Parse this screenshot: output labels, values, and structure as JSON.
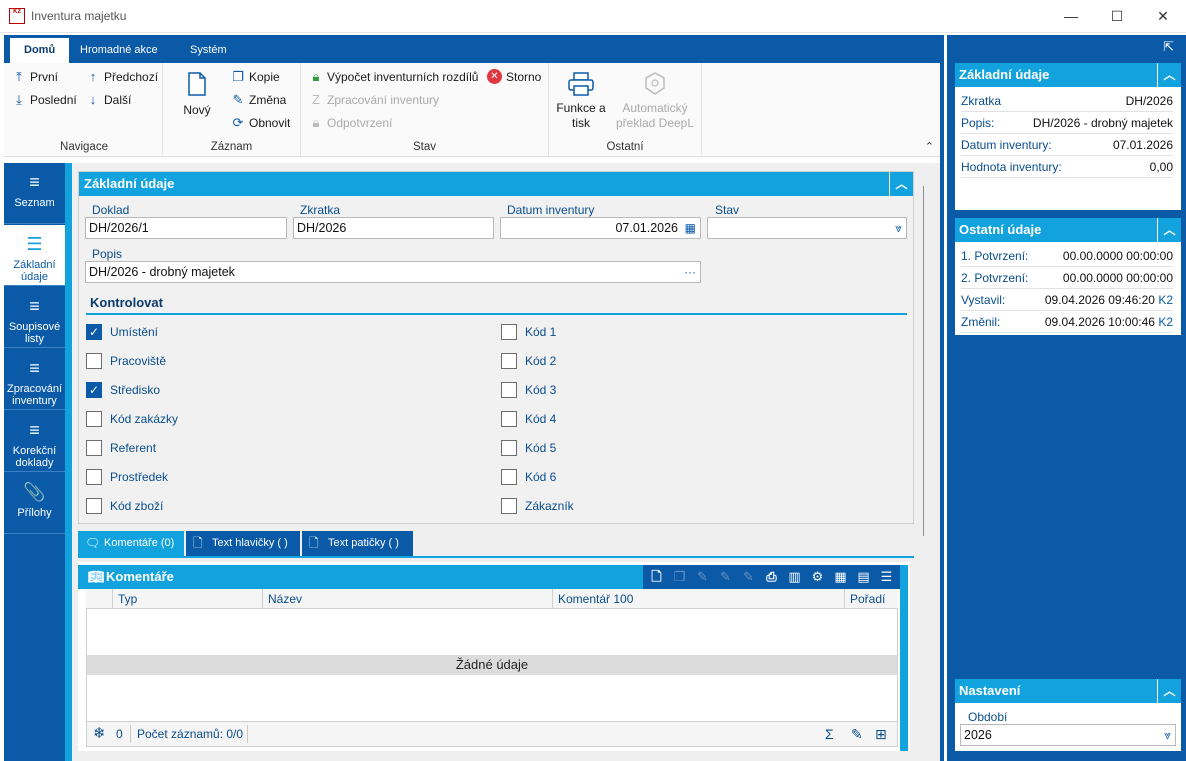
{
  "window": {
    "title": "Inventura majetku",
    "logo_text": "K2",
    "minimize": "—",
    "maximize": "☐",
    "close": "✕"
  },
  "ribbon": {
    "tabs": [
      "Domů",
      "Hromadné akce",
      "Systém"
    ],
    "navigace": {
      "label": "Navigace",
      "first": "První",
      "last": "Poslední",
      "prev": "Předchozí",
      "next": "Další"
    },
    "zaznam": {
      "label": "Záznam",
      "new": "Nový",
      "copy": "Kopie",
      "change": "Změna",
      "refresh": "Obnovit"
    },
    "stav": {
      "label": "Stav",
      "calc": "Výpočet inventurních rozdílů",
      "cancel": "Storno",
      "process": "Zpracování inventury",
      "unconfirm": "Odpotvrzení"
    },
    "ostatni": {
      "label": "Ostatní",
      "print_line1": "Funkce a",
      "print_line2": "tisk",
      "deepl_line1": "Automatický",
      "deepl_line2": "překlad DeepL"
    }
  },
  "nav": {
    "items": [
      {
        "label": "Seznam",
        "icon": "≡"
      },
      {
        "label": "Základní údaje",
        "icon": "☰"
      },
      {
        "label": "Soupisové listy",
        "icon": "≡"
      },
      {
        "label": "Zpracování inventury",
        "icon": "≡"
      },
      {
        "label": "Korekční doklady",
        "icon": "≡"
      },
      {
        "label": "Přílohy",
        "icon": "📎"
      }
    ]
  },
  "main": {
    "title": "Základní údaje",
    "fields": {
      "doklad_label": "Doklad",
      "doklad_value": "DH/2026/1",
      "zkratka_label": "Zkratka",
      "zkratka_value": "DH/2026",
      "datum_label": "Datum inventury",
      "datum_value": "07.01.2026",
      "stav_label": "Stav",
      "stav_value": "",
      "popis_label": "Popis",
      "popis_value": "DH/2026 - drobný majetek"
    },
    "kontrolovat": {
      "title": "Kontrolovat",
      "left": [
        {
          "label": "Umístění",
          "checked": true
        },
        {
          "label": "Pracoviště",
          "checked": false
        },
        {
          "label": "Středisko",
          "checked": true
        },
        {
          "label": "Kód zakázky",
          "checked": false
        },
        {
          "label": "Referent",
          "checked": false
        },
        {
          "label": "Prostředek",
          "checked": false
        },
        {
          "label": "Kód zboží",
          "checked": false
        }
      ],
      "right": [
        {
          "label": "Kód 1",
          "checked": false
        },
        {
          "label": "Kód 2",
          "checked": false
        },
        {
          "label": "Kód 3",
          "checked": false
        },
        {
          "label": "Kód 4",
          "checked": false
        },
        {
          "label": "Kód 5",
          "checked": false
        },
        {
          "label": "Kód 6",
          "checked": false
        },
        {
          "label": "Zákazník",
          "checked": false
        }
      ]
    },
    "tabs": [
      "Komentáře (0)",
      "Text hlavičky ( )",
      "Text patičky ( )"
    ],
    "grid": {
      "title": "Komentáře",
      "columns": [
        "Typ",
        "Název",
        "Komentář 100",
        "Pořadí"
      ],
      "empty": "Žádné údaje",
      "footer_count": "0",
      "footer_records": "Počet záznamů: 0/0"
    }
  },
  "right_panel": {
    "zakladni": {
      "title": "Základní údaje",
      "rows": [
        {
          "k": "Zkratka",
          "v": "DH/2026"
        },
        {
          "k": "Popis:",
          "v": "DH/2026 - drobný majetek"
        },
        {
          "k": "Datum inventury:",
          "v": "07.01.2026"
        },
        {
          "k": "Hodnota inventury:",
          "v": "0,00"
        }
      ]
    },
    "ostatni": {
      "title": "Ostatní údaje",
      "rows": [
        {
          "k": "1. Potvrzení:",
          "v": "00.00.0000 00:00:00",
          "s": ""
        },
        {
          "k": "2. Potvrzení:",
          "v": "00.00.0000 00:00:00",
          "s": ""
        },
        {
          "k": "Vystavil:",
          "v": "09.04.2026 09:46:20",
          "s": "K2"
        },
        {
          "k": "Změnil:",
          "v": "09.04.2026 10:00:46",
          "s": "K2"
        }
      ]
    },
    "nastaveni": {
      "title": "Nastavení",
      "obdobi_label": "Období",
      "obdobi_value": "2026"
    }
  },
  "colors": {
    "dark_blue": "#0a5aa8",
    "light_blue": "#12a3df",
    "check_blue": "#0a5aa8"
  }
}
